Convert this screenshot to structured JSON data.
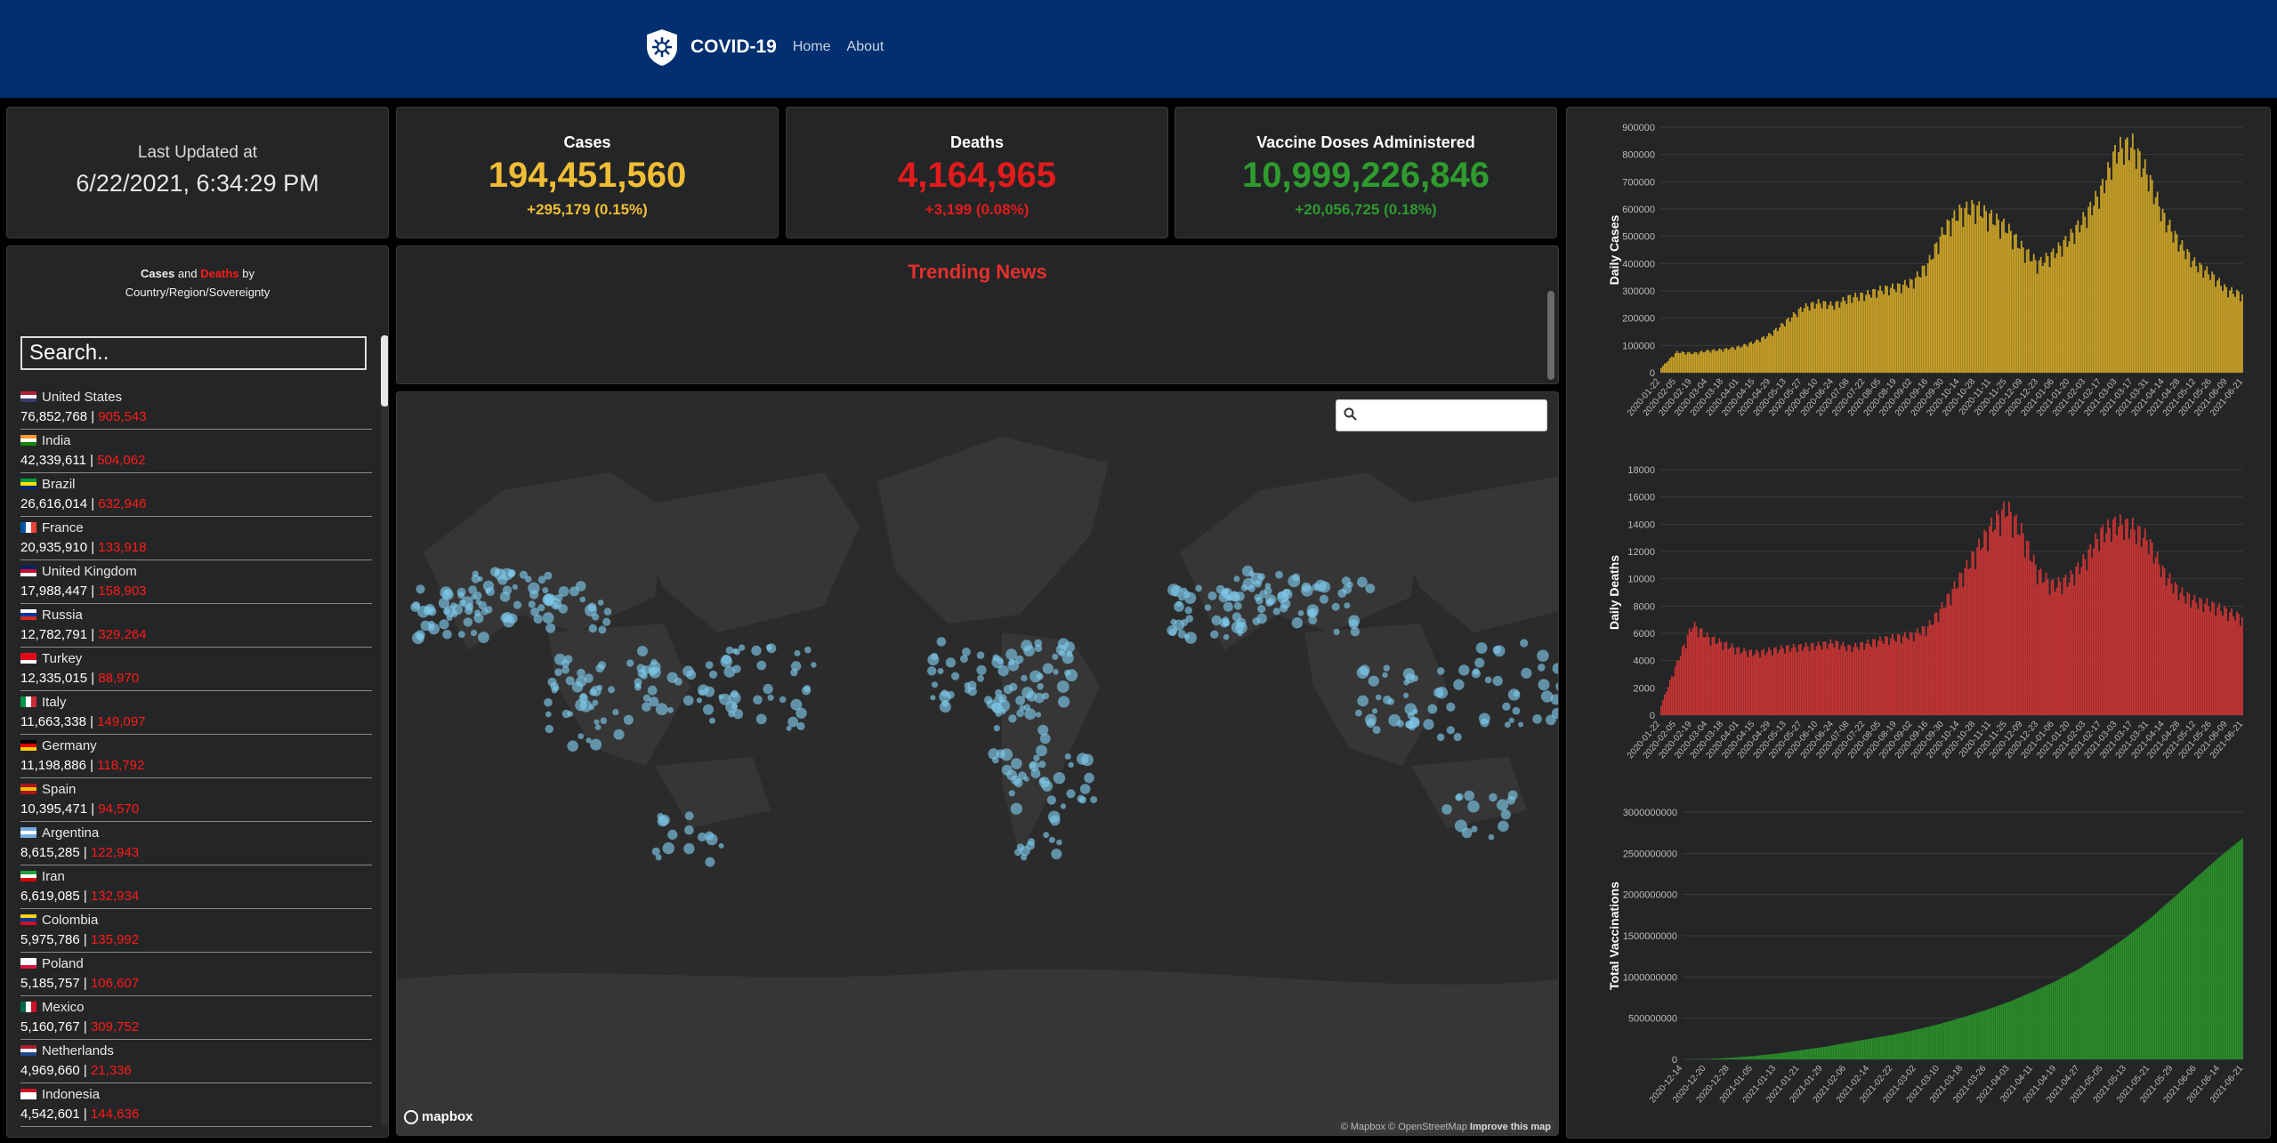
{
  "nav": {
    "brand": "COVID-19",
    "links": [
      "Home",
      "About"
    ]
  },
  "updated": {
    "label": "Last Updated at",
    "value": "6/22/2021, 6:34:29 PM"
  },
  "stats": {
    "cases": {
      "title": "Cases",
      "value": "194,451,560",
      "delta": "+295,179 (0.15%)",
      "color": "#f0be36"
    },
    "deaths": {
      "title": "Deaths",
      "value": "4,164,965",
      "delta": "+3,199 (0.08%)",
      "color": "#e31b1b"
    },
    "vaccines": {
      "title": "Vaccine Doses Administered",
      "value": "10,999,226,846",
      "delta": "+20,056,725 (0.18%)",
      "color": "#2e9b2e"
    }
  },
  "country_panel": {
    "heading_cases": "Cases",
    "heading_and": "and",
    "heading_deaths": "Deaths",
    "heading_by": "by",
    "heading_sub": "Country/Region/Sovereignty",
    "search_placeholder": "Search..",
    "countries": [
      {
        "name": "United States",
        "cases": "76,852,768",
        "deaths": "905,543",
        "flag": "us"
      },
      {
        "name": "India",
        "cases": "42,339,611",
        "deaths": "504,062",
        "flag": "in"
      },
      {
        "name": "Brazil",
        "cases": "26,616,014",
        "deaths": "632,946",
        "flag": "br"
      },
      {
        "name": "France",
        "cases": "20,935,910",
        "deaths": "133,918",
        "flag": "fr"
      },
      {
        "name": "United Kingdom",
        "cases": "17,988,447",
        "deaths": "158,903",
        "flag": "gb"
      },
      {
        "name": "Russia",
        "cases": "12,782,791",
        "deaths": "329,264",
        "flag": "ru"
      },
      {
        "name": "Turkey",
        "cases": "12,335,015",
        "deaths": "88,970",
        "flag": "tr"
      },
      {
        "name": "Italy",
        "cases": "11,663,338",
        "deaths": "149,097",
        "flag": "it"
      },
      {
        "name": "Germany",
        "cases": "11,198,886",
        "deaths": "118,792",
        "flag": "de"
      },
      {
        "name": "Spain",
        "cases": "10,395,471",
        "deaths": "94,570",
        "flag": "es"
      },
      {
        "name": "Argentina",
        "cases": "8,615,285",
        "deaths": "122,943",
        "flag": "ar"
      },
      {
        "name": "Iran",
        "cases": "6,619,085",
        "deaths": "132,934",
        "flag": "ir"
      },
      {
        "name": "Colombia",
        "cases": "5,975,786",
        "deaths": "135,992",
        "flag": "co"
      },
      {
        "name": "Poland",
        "cases": "5,185,757",
        "deaths": "106,607",
        "flag": "pl"
      },
      {
        "name": "Mexico",
        "cases": "5,160,767",
        "deaths": "309,752",
        "flag": "mx"
      },
      {
        "name": "Netherlands",
        "cases": "4,969,660",
        "deaths": "21,336",
        "flag": "nl"
      },
      {
        "name": "Indonesia",
        "cases": "4,542,601",
        "deaths": "144,636",
        "flag": "id"
      }
    ]
  },
  "news": {
    "title": "Trending News"
  },
  "map": {
    "search_placeholder": "",
    "logo_text": "mapbox",
    "attribution_1": "© Mapbox © OpenStreetMap",
    "attribution_2": "Improve this map"
  },
  "chart_data": [
    {
      "type": "bar",
      "ylabel": "Daily Cases",
      "ylim": [
        0,
        900000
      ],
      "yticks": [
        "0",
        "100000",
        "200000",
        "300000",
        "400000",
        "500000",
        "600000",
        "700000",
        "800000",
        "900000"
      ],
      "xticks": [
        "2020-01-22",
        "2020-02-05",
        "2020-02-19",
        "2020-03-04",
        "2020-03-18",
        "2020-04-01",
        "2020-04-15",
        "2020-04-29",
        "2020-05-13",
        "2020-05-27",
        "2020-06-10",
        "2020-06-24",
        "2020-07-08",
        "2020-07-22",
        "2020-08-05",
        "2020-08-19",
        "2020-09-02",
        "2020-09-16",
        "2020-09-30",
        "2020-10-14",
        "2020-10-28",
        "2020-11-11",
        "2020-11-25",
        "2020-12-09",
        "2020-12-23",
        "2021-01-06",
        "2021-01-20",
        "2021-02-03",
        "2021-02-17",
        "2021-03-03",
        "2021-03-17",
        "2021-03-31",
        "2021-04-14",
        "2021-04-28",
        "2021-05-12",
        "2021-05-26",
        "2021-06-09",
        "2021-06-21"
      ],
      "color": "#c9a227",
      "values": [
        20000,
        80000,
        75000,
        85000,
        90000,
        100000,
        120000,
        150000,
        200000,
        250000,
        270000,
        260000,
        290000,
        300000,
        320000,
        330000,
        350000,
        420000,
        550000,
        620000,
        640000,
        600000,
        560000,
        480000,
        420000,
        460000,
        520000,
        600000,
        700000,
        860000,
        880000,
        760000,
        600000,
        500000,
        420000,
        380000,
        320000,
        300000
      ]
    },
    {
      "type": "bar",
      "ylabel": "Daily Deaths",
      "ylim": [
        0,
        18000
      ],
      "yticks": [
        "0",
        "2000",
        "4000",
        "6000",
        "8000",
        "10000",
        "12000",
        "14000",
        "16000",
        "18000"
      ],
      "xticks": [
        "2020-01-22",
        "2020-02-05",
        "2020-02-19",
        "2020-03-04",
        "2020-03-18",
        "2020-04-01",
        "2020-04-15",
        "2020-04-29",
        "2020-05-13",
        "2020-05-27",
        "2020-06-10",
        "2020-06-24",
        "2020-07-08",
        "2020-07-22",
        "2020-08-05",
        "2020-08-19",
        "2020-09-02",
        "2020-09-16",
        "2020-09-30",
        "2020-10-14",
        "2020-10-28",
        "2020-11-11",
        "2020-11-25",
        "2020-12-09",
        "2020-12-23",
        "2021-01-06",
        "2021-01-20",
        "2021-02-03",
        "2021-02-17",
        "2021-03-03",
        "2021-03-17",
        "2021-03-31",
        "2021-04-14",
        "2021-04-28",
        "2021-05-12",
        "2021-05-26",
        "2021-06-09",
        "2021-06-21"
      ],
      "color": "#c63434",
      "values": [
        800,
        4000,
        7000,
        6000,
        5500,
        5000,
        4800,
        5000,
        5200,
        5300,
        5400,
        5600,
        5200,
        5500,
        5800,
        6000,
        6200,
        6800,
        8500,
        10500,
        12500,
        14500,
        16000,
        14000,
        11000,
        10000,
        10500,
        12000,
        14000,
        14800,
        14500,
        13500,
        11000,
        9500,
        8800,
        8500,
        8000,
        7500
      ]
    },
    {
      "type": "bar",
      "ylabel": "Total Vaccinations",
      "ylim": [
        0,
        3000000000
      ],
      "yticks": [
        "0",
        "500000000",
        "1000000000",
        "1500000000",
        "2000000000",
        "2500000000",
        "3000000000"
      ],
      "xticks": [
        "2020-12-14",
        "2020-12-20",
        "2020-12-28",
        "2021-01-05",
        "2021-01-13",
        "2021-01-21",
        "2021-01-29",
        "2021-02-06",
        "2021-02-14",
        "2021-02-22",
        "2021-03-02",
        "2021-03-10",
        "2021-03-18",
        "2021-03-26",
        "2021-04-03",
        "2021-04-11",
        "2021-04-19",
        "2021-04-27",
        "2021-05-05",
        "2021-05-13",
        "2021-05-21",
        "2021-05-29",
        "2021-06-06",
        "2021-06-14",
        "2021-06-21"
      ],
      "color": "#2a8f2a",
      "values": [
        0,
        5000000,
        20000000,
        40000000,
        70000000,
        110000000,
        150000000,
        200000000,
        250000000,
        300000000,
        360000000,
        430000000,
        510000000,
        600000000,
        700000000,
        820000000,
        950000000,
        1100000000,
        1280000000,
        1480000000,
        1700000000,
        1950000000,
        2200000000,
        2450000000,
        2680000000
      ]
    }
  ]
}
